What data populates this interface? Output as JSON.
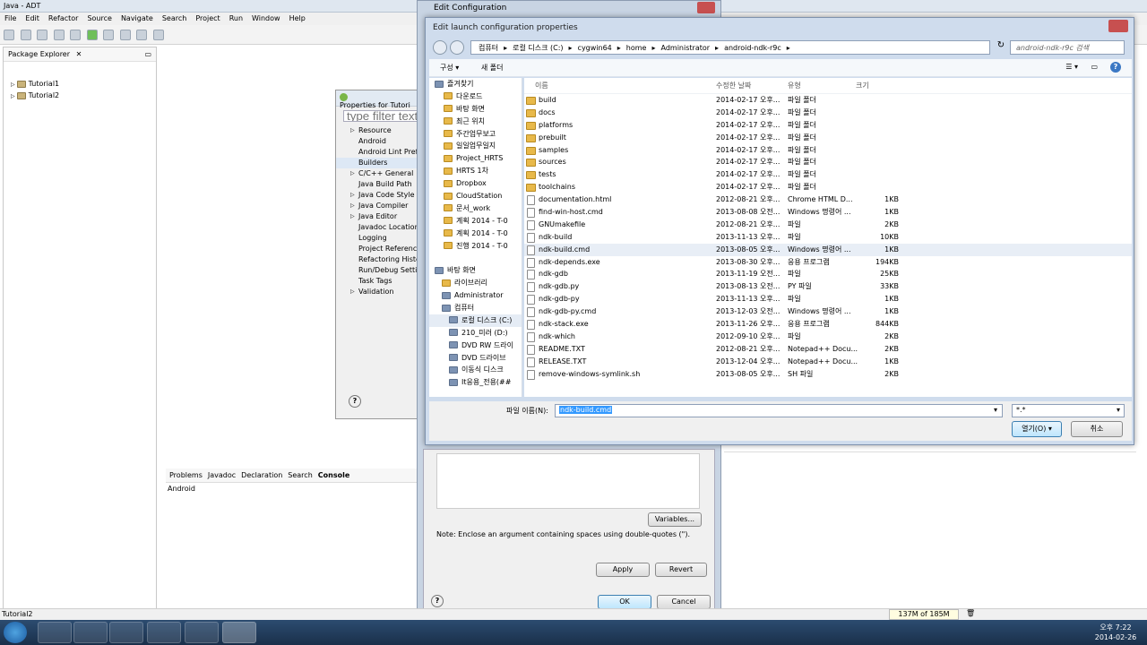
{
  "window": {
    "title": "Java - ADT"
  },
  "menu": [
    "File",
    "Edit",
    "Refactor",
    "Source",
    "Navigate",
    "Search",
    "Project",
    "Run",
    "Window",
    "Help"
  ],
  "package_explorer": {
    "title": "Package Explorer",
    "items": [
      "Tutorial1",
      "Tutorial2"
    ]
  },
  "properties": {
    "title": "Properties for Tutori",
    "filter_placeholder": "type filter text",
    "items": [
      "Resource",
      "Android",
      "Android Lint Prefe",
      "Builders",
      "C/C++ General",
      "Java Build Path",
      "Java Code Style",
      "Java Compiler",
      "Java Editor",
      "Javadoc Location",
      "Logging",
      "Project References",
      "Refactoring Histor",
      "Run/Debug Setting",
      "Task Tags",
      "Validation"
    ]
  },
  "edit_config": {
    "title": "Edit Configuration",
    "note": "Note: Enclose an argument containing spaces using double-quotes (\").",
    "variables": "Variables...",
    "apply": "Apply",
    "revert": "Revert",
    "ok": "OK",
    "cancel": "Cancel"
  },
  "console": {
    "tabs": [
      "Problems",
      "Javadoc",
      "Declaration",
      "Search",
      "Console"
    ],
    "content": "Android"
  },
  "file_dialog": {
    "title": "Edit launch configuration properties",
    "breadcrumb": [
      "컴퓨터",
      "로컬 디스크 (C:)",
      "cygwin64",
      "home",
      "Administrator",
      "android-ndk-r9c"
    ],
    "search_placeholder": "android-ndk-r9c 검색",
    "organize": "구성 ▾",
    "new_folder": "새 폴더",
    "columns": {
      "name": "이름",
      "date": "수정한 날짜",
      "type": "유형",
      "size": "크기"
    },
    "nav": [
      "즐겨찾기",
      "다운로드",
      "바탕 화면",
      "최근 위치",
      "주간업무보고",
      "일일업무일지",
      "Project_HRTS",
      "HRTS 1차",
      "Dropbox",
      "CloudStation",
      "문서_work",
      "계획 2014 - T-0",
      "계획 2014 - T-0",
      "진행 2014 - T-0",
      "",
      "바탕 화면",
      "라이브러리",
      "Administrator",
      "컴퓨터",
      "로컬 디스크 (C:)",
      "210_미러 (D:)",
      "DVD RW 드라이",
      "DVD 드라이브",
      "이동식 디스크",
      "It응용_전용(##"
    ],
    "files": [
      {
        "name": "build",
        "date": "2014-02-17 오후...",
        "type": "파일 폴더",
        "size": "",
        "folder": true
      },
      {
        "name": "docs",
        "date": "2014-02-17 오후...",
        "type": "파일 폴더",
        "size": "",
        "folder": true
      },
      {
        "name": "platforms",
        "date": "2014-02-17 오후...",
        "type": "파일 폴더",
        "size": "",
        "folder": true
      },
      {
        "name": "prebuilt",
        "date": "2014-02-17 오후...",
        "type": "파일 폴더",
        "size": "",
        "folder": true
      },
      {
        "name": "samples",
        "date": "2014-02-17 오후...",
        "type": "파일 폴더",
        "size": "",
        "folder": true
      },
      {
        "name": "sources",
        "date": "2014-02-17 오후...",
        "type": "파일 폴더",
        "size": "",
        "folder": true
      },
      {
        "name": "tests",
        "date": "2014-02-17 오후...",
        "type": "파일 폴더",
        "size": "",
        "folder": true
      },
      {
        "name": "toolchains",
        "date": "2014-02-17 오후...",
        "type": "파일 폴더",
        "size": "",
        "folder": true
      },
      {
        "name": "documentation.html",
        "date": "2012-08-21 오후...",
        "type": "Chrome HTML D...",
        "size": "1KB",
        "folder": false
      },
      {
        "name": "find-win-host.cmd",
        "date": "2013-08-08 오전...",
        "type": "Windows 명령어 ...",
        "size": "1KB",
        "folder": false
      },
      {
        "name": "GNUmakefile",
        "date": "2012-08-21 오후...",
        "type": "파일",
        "size": "2KB",
        "folder": false
      },
      {
        "name": "ndk-build",
        "date": "2013-11-13 오후...",
        "type": "파일",
        "size": "10KB",
        "folder": false
      },
      {
        "name": "ndk-build.cmd",
        "date": "2013-08-05 오후...",
        "type": "Windows 명령어 ...",
        "size": "1KB",
        "folder": false,
        "selected": true
      },
      {
        "name": "ndk-depends.exe",
        "date": "2013-08-30 오후...",
        "type": "응용 프로그램",
        "size": "194KB",
        "folder": false
      },
      {
        "name": "ndk-gdb",
        "date": "2013-11-19 오전...",
        "type": "파일",
        "size": "25KB",
        "folder": false
      },
      {
        "name": "ndk-gdb.py",
        "date": "2013-08-13 오전...",
        "type": "PY 파일",
        "size": "33KB",
        "folder": false
      },
      {
        "name": "ndk-gdb-py",
        "date": "2013-11-13 오후...",
        "type": "파일",
        "size": "1KB",
        "folder": false
      },
      {
        "name": "ndk-gdb-py.cmd",
        "date": "2013-12-03 오전...",
        "type": "Windows 명령어 ...",
        "size": "1KB",
        "folder": false
      },
      {
        "name": "ndk-stack.exe",
        "date": "2013-11-26 오후...",
        "type": "응용 프로그램",
        "size": "844KB",
        "folder": false
      },
      {
        "name": "ndk-which",
        "date": "2012-09-10 오후...",
        "type": "파일",
        "size": "2KB",
        "folder": false
      },
      {
        "name": "README.TXT",
        "date": "2012-08-21 오후...",
        "type": "Notepad++ Docu...",
        "size": "2KB",
        "folder": false
      },
      {
        "name": "RELEASE.TXT",
        "date": "2013-12-04 오후...",
        "type": "Notepad++ Docu...",
        "size": "1KB",
        "folder": false
      },
      {
        "name": "remove-windows-symlink.sh",
        "date": "2013-08-05 오후...",
        "type": "SH 파일",
        "size": "2KB",
        "folder": false
      }
    ],
    "filename_label": "파일 이름(N):",
    "filename_value": "ndk-build.cmd",
    "filetype_value": "*.*",
    "open_button": "열기(O)",
    "cancel_button": "취소"
  },
  "status": {
    "left": "Tutorial2",
    "memory": "137M of 185M"
  },
  "clock": {
    "time": "오후 7:22",
    "date": "2014-02-26"
  }
}
